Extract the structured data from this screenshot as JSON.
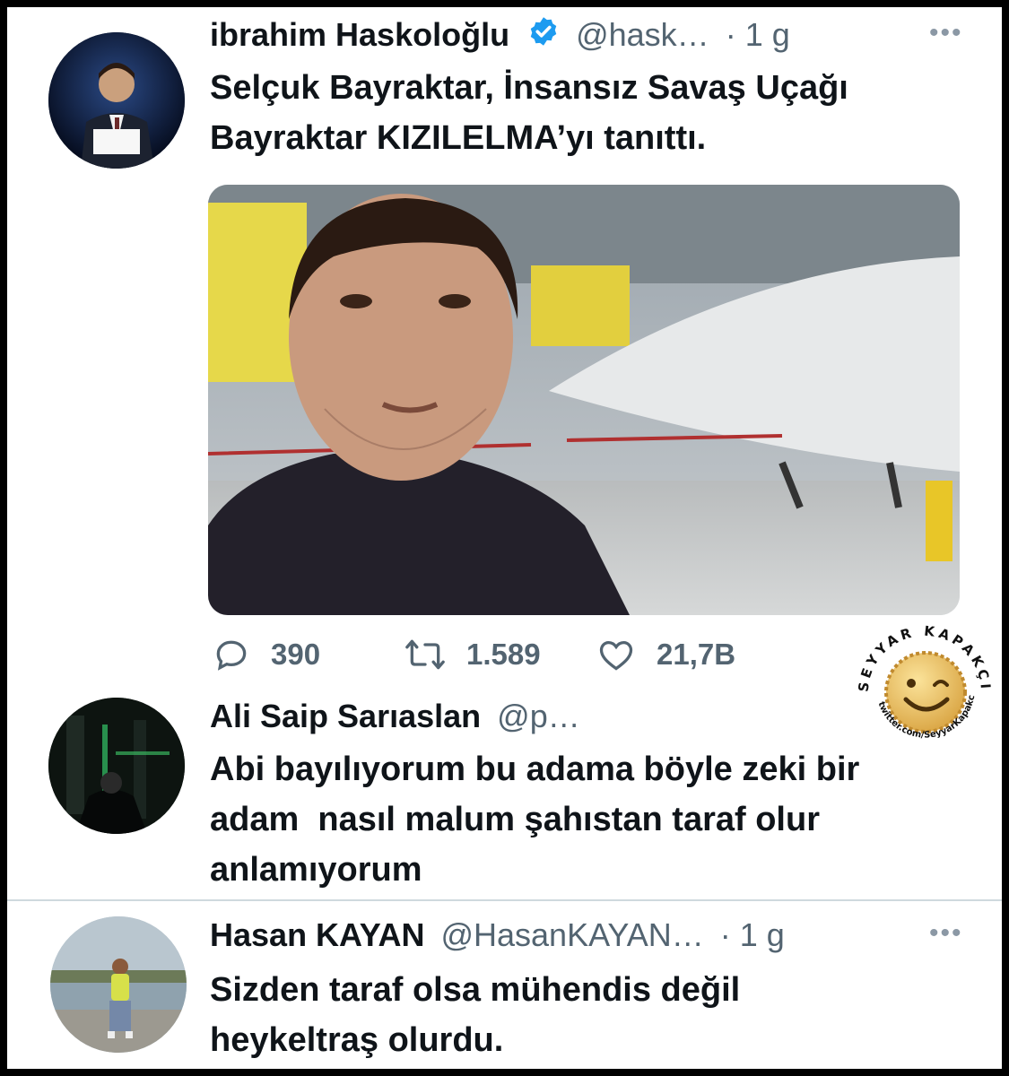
{
  "tweet": {
    "author": "ibrahim Haskoloğlu",
    "handle": "@hask…",
    "time": "· 1 g",
    "text_line1": "Selçuk Bayraktar, İnsansız Savaş Uçağı",
    "text_line2": "Bayraktar KIZILELMA’yı tanıttı.",
    "replies": "390",
    "retweets": "1.589",
    "likes": "21,7B"
  },
  "reply1": {
    "author": "Ali Saip Sarıaslan",
    "handle": "@p…",
    "line1": "Abi bayılıyorum bu adama böyle zeki bir",
    "line2": "adam  nasıl malum şahıstan taraf olur",
    "line3": "anlamıyorum"
  },
  "reply2": {
    "author": "Hasan KAYAN",
    "handle": "@HasanKAYAN…",
    "time": "· 1 g",
    "line1": "Sizden taraf olsa mühendis değil",
    "line2": "heykeltraş olurdu."
  },
  "watermark": {
    "arc_text": "SEYYAR KAPAKÇI",
    "url": "twitter.com/SeyyarKapakci"
  },
  "colors": {
    "verified": "#1d9bf0",
    "muted": "#536471",
    "text": "#0f1419"
  },
  "icons": [
    "more-icon",
    "verified-icon",
    "reply-icon",
    "retweet-icon",
    "like-icon"
  ]
}
